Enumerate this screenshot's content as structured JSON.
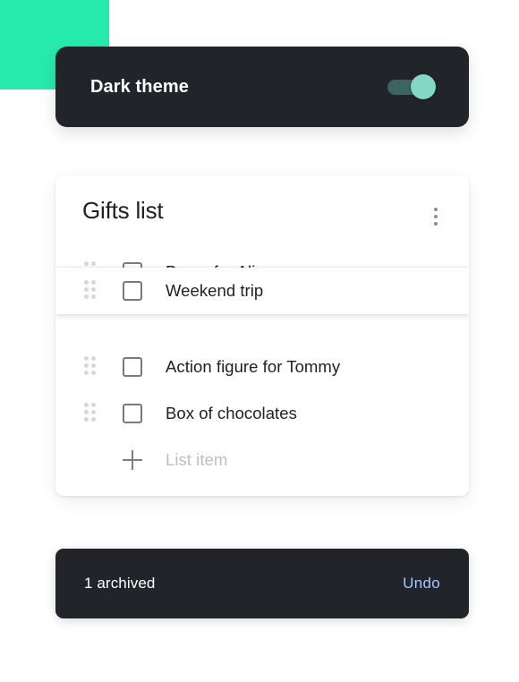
{
  "theme": {
    "accent_block_color": "#27ebac",
    "card_background": "#212429",
    "label": "Dark theme",
    "toggle": {
      "state": "on",
      "track_color": "#3b6560",
      "thumb_color": "#84d6c6"
    }
  },
  "list_card": {
    "title": "Gifts list",
    "overflow_menu": "more-vert",
    "items": [
      {
        "label": "Dress for Alice",
        "checked": false,
        "state": "displaced"
      },
      {
        "label": "Weekend trip",
        "checked": false,
        "state": "dragging"
      },
      {
        "label": "Action figure for Tommy",
        "checked": false,
        "state": "normal"
      },
      {
        "label": "Box of chocolates",
        "checked": false,
        "state": "normal"
      }
    ],
    "add_row": {
      "icon": "plus-icon",
      "placeholder": "List item"
    }
  },
  "snackbar": {
    "message": "1 archived",
    "action_label": "Undo",
    "action_color": "#a8c7fa",
    "background": "#212429"
  }
}
